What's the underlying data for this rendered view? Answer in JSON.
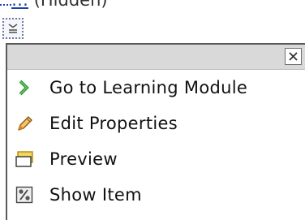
{
  "top": {
    "link_text": "…",
    "status_text": "(Hidden)"
  },
  "menu": {
    "items": [
      {
        "label": "Go to Learning Module",
        "icon": "green-chevron-right-icon"
      },
      {
        "label": "Edit Properties",
        "icon": "pencil-icon"
      },
      {
        "label": "Preview",
        "icon": "preview-window-icon"
      },
      {
        "label": "Show Item",
        "icon": "show-item-icon"
      }
    ]
  },
  "colors": {
    "link": "#1f3fa8",
    "header_bg": "#d9d9d9",
    "chevron_green": "#2e9a2e",
    "pencil_orange": "#e08a1e",
    "preview_yellow": "#f6d55c"
  }
}
